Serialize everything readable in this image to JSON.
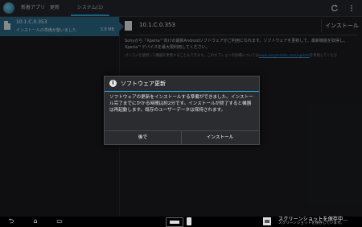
{
  "actionbar": {
    "tabs": [
      "新着アプリ",
      "更新",
      "システム(1)"
    ],
    "active_tab": 2
  },
  "list": {
    "items": [
      {
        "title": "10.1.C.0.353",
        "subtitle": "インストールの準備が整いました",
        "size": "3.8 MB"
      }
    ]
  },
  "detail": {
    "title": "10.1.C.0.353",
    "install_button": "インストール",
    "description": "Sonyから「Xperia™向けの最新Androidソフトウェアがご利用になれます。ソフトウェアを更新して、最新機能を取得し、Xperia™デバイスを最大限利用してください。",
    "pc_note": "パソコンを使用して機器を更新することもできます。このオプションの詳細については",
    "pc_link": "www.sonymobile.com/update",
    "pc_note_end": "を参照してくださ"
  },
  "dialog": {
    "title": "ソフトウェア更新",
    "info_glyph": "i",
    "body": "ソフトウェアの更新をインストールする準備ができました。インストール完了までにかかる時間は約2分です。インストールが終了すると機器は再起動します。既存のユーザーデータは保持されます。",
    "later_button": "後で",
    "install_button": "インストール"
  },
  "systembar": {
    "back_glyph": "⮌",
    "home_glyph": "⌂",
    "recent_glyph": "▭",
    "notification_title": "スクリーンショットを保存中...",
    "notification_sub": "スクリーンショットを保存しています。"
  },
  "colors": {
    "accent": "#2ea7e0",
    "selected_item": "#2a6b8a"
  }
}
